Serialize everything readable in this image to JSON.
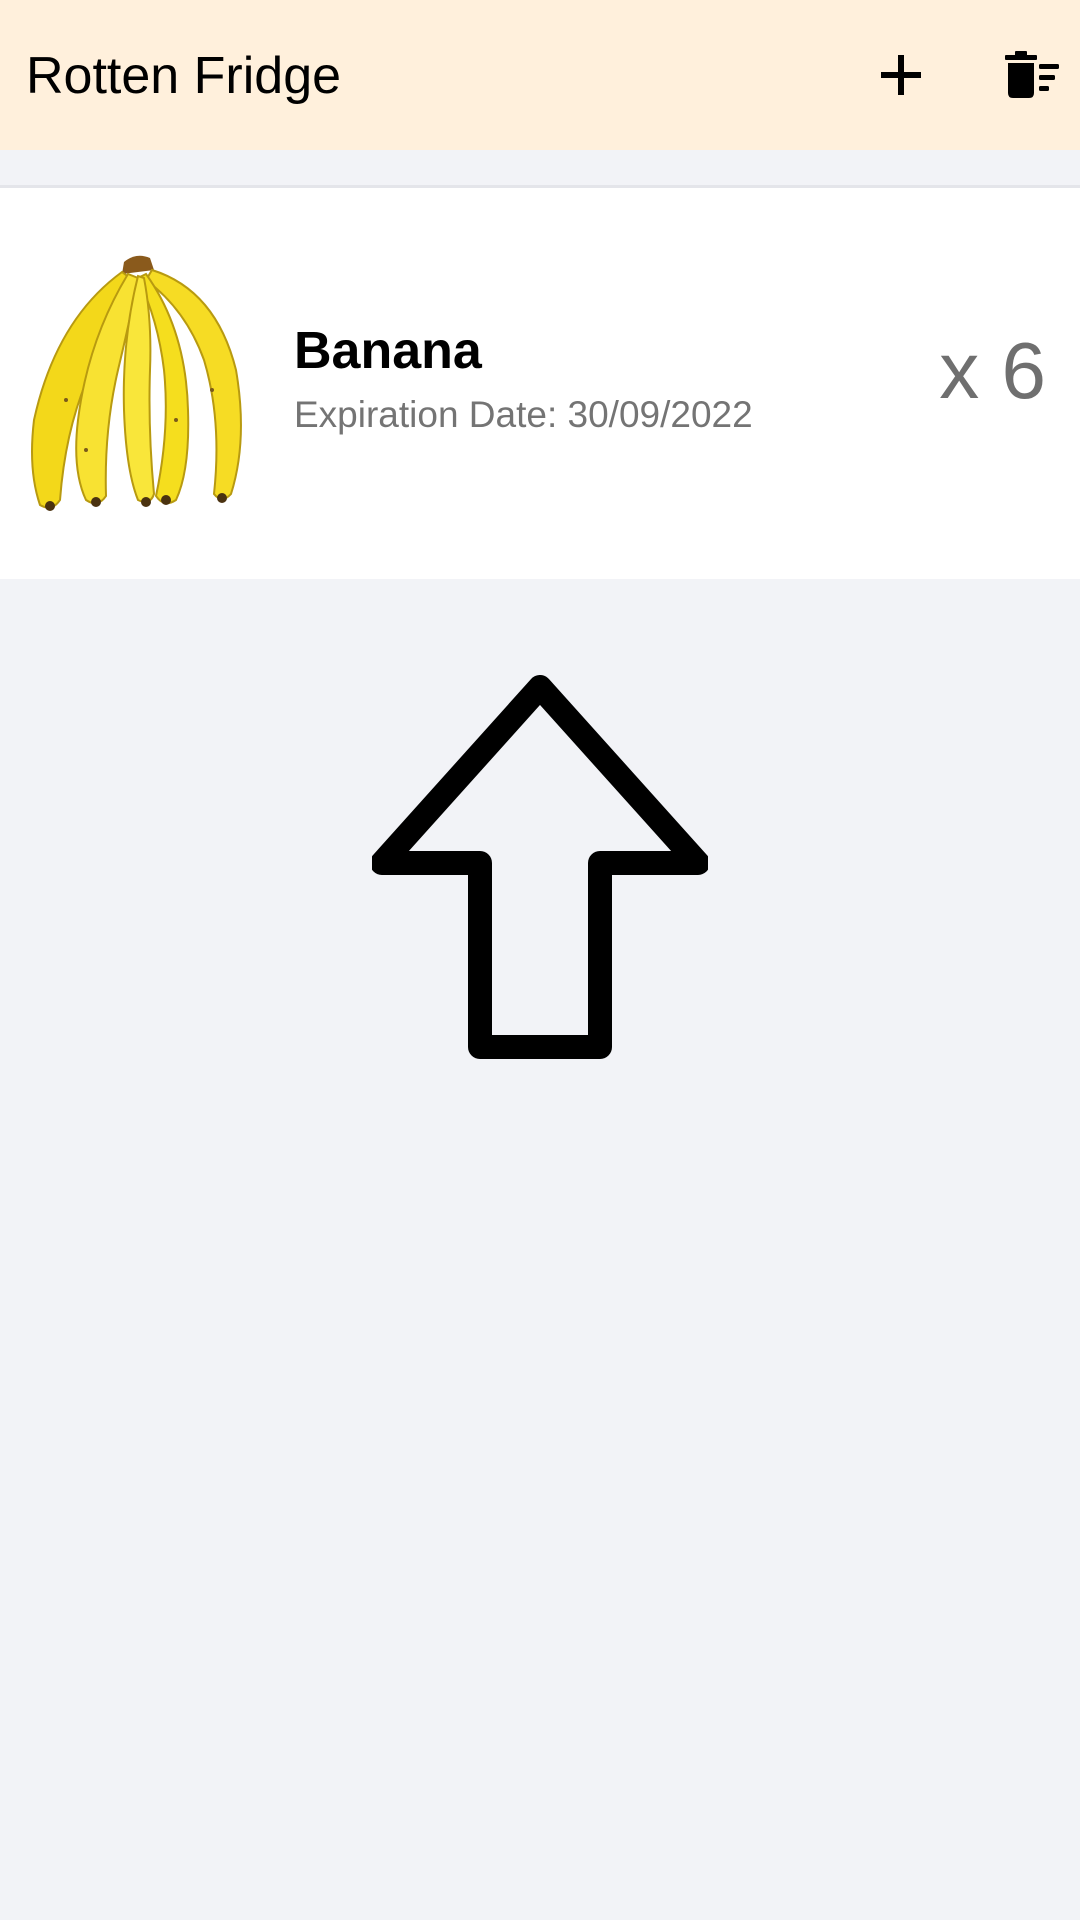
{
  "app_bar": {
    "title": "Rotten Fridge",
    "add_icon": "plus-icon",
    "clear_icon": "delete-sweep-icon",
    "background_color": "#fff0dc"
  },
  "items": [
    {
      "name": "Banana",
      "expiration": "Expiration Date: 30/09/2022",
      "quantity": "x 6",
      "image_icon": "banana-image"
    }
  ],
  "empty_hint": {
    "icon": "up-arrow-icon"
  },
  "colors": {
    "page_background": "#f2f3f7",
    "card_background": "#ffffff",
    "secondary_text": "#747474",
    "banana_yellow": "#f7e21c"
  }
}
